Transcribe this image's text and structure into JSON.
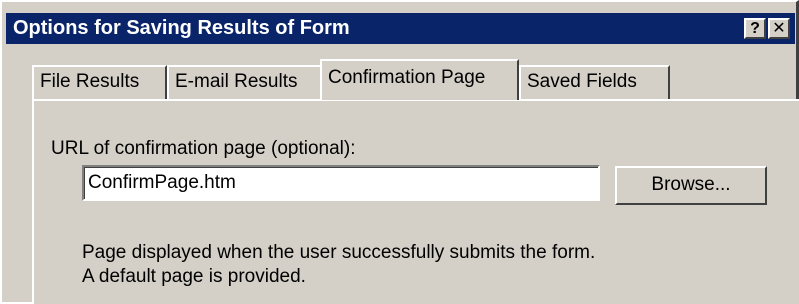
{
  "window": {
    "title": "Options for Saving Results of Form",
    "help_label": "?",
    "close_label": "✕"
  },
  "tabs": [
    {
      "label": "File Results",
      "active": false
    },
    {
      "label": "E-mail Results",
      "active": false
    },
    {
      "label": "Confirmation Page",
      "active": true
    },
    {
      "label": "Saved Fields",
      "active": false
    }
  ],
  "confirmation": {
    "url_label": "URL of confirmation page (optional):",
    "url_value": "ConfirmPage.htm",
    "browse_label": "Browse...",
    "description_line1": "Page displayed when the user successfully submits the form.",
    "description_line2": "A default page is provided."
  },
  "colors": {
    "title_bar": "#0a246a",
    "face": "#d4d0c8"
  },
  "icons": {
    "help": "help-icon",
    "close": "close-icon"
  }
}
